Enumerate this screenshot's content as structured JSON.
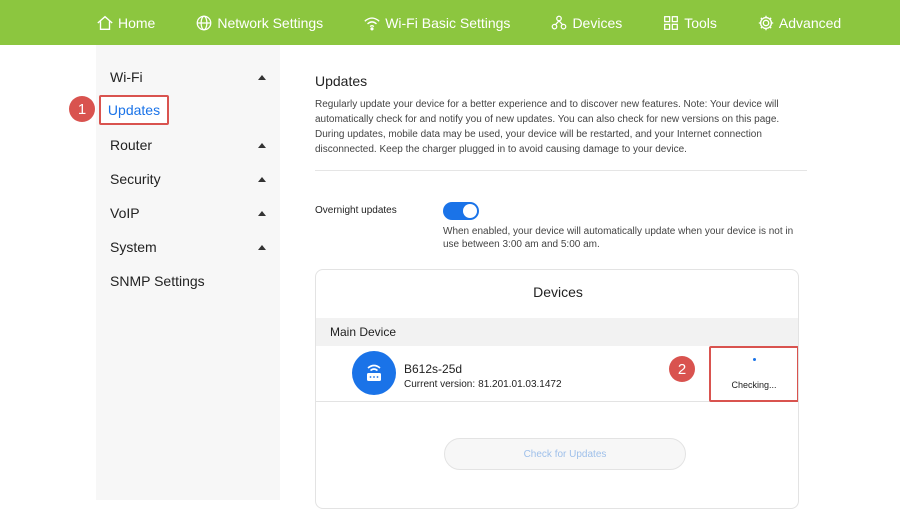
{
  "nav": {
    "items": [
      {
        "label": "Home",
        "icon": "home-icon"
      },
      {
        "label": "Network Settings",
        "icon": "globe-icon"
      },
      {
        "label": "Wi-Fi Basic Settings",
        "icon": "wifi-icon"
      },
      {
        "label": "Devices",
        "icon": "devices-icon"
      },
      {
        "label": "Tools",
        "icon": "tools-icon"
      },
      {
        "label": "Advanced",
        "icon": "gear-icon"
      }
    ],
    "bg_color": "#8cc63f"
  },
  "sidebar": {
    "wifi": "Wi-Fi",
    "updates": "Updates",
    "router": "Router",
    "security": "Security",
    "voip": "VoIP",
    "system": "System",
    "snmp": "SNMP Settings"
  },
  "annotations": {
    "one": "1",
    "two": "2",
    "color": "#d9534f"
  },
  "main": {
    "title": "Updates",
    "description": "Regularly update your device for a better experience and to discover new features. Note: Your device will automatically check for and notify you of new updates. You can also check for new versions on this page. During updates, mobile data may be used, your device will be restarted, and your Internet connection disconnected. Keep the charger plugged in to avoid causing damage to your device.",
    "overnight_label": "Overnight updates",
    "overnight_enabled": true,
    "overnight_desc": "When enabled, your device will automatically update when your device is not in use between 3:00 am and 5:00 am.",
    "devices_title": "Devices",
    "main_device_label": "Main Device",
    "device": {
      "name": "B612s-25d",
      "version_label": "Current version:",
      "version": "81.201.01.03.1472",
      "status": "Checking..."
    },
    "check_button": "Check for Updates",
    "accent_color": "#1a73e8"
  }
}
